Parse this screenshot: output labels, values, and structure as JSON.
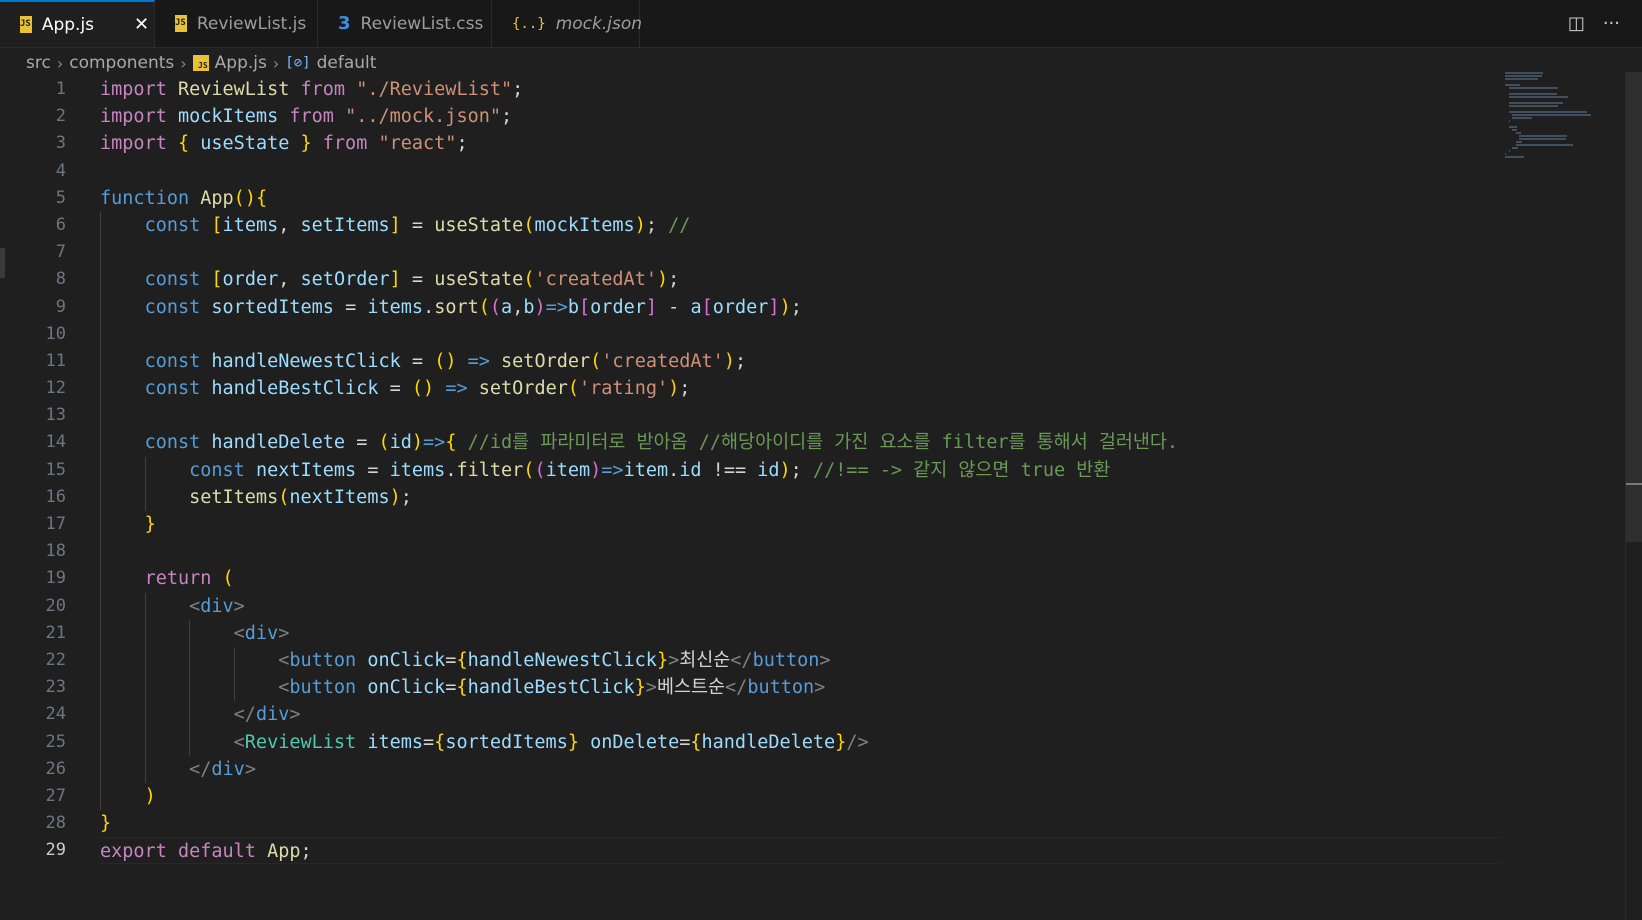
{
  "tabs": [
    {
      "label": "App.js",
      "icon": "js-icon",
      "active": true
    },
    {
      "label": "ReviewList.js",
      "icon": "js-icon",
      "active": false
    },
    {
      "label": "ReviewList.css",
      "icon": "css-icon",
      "active": false
    },
    {
      "label": "mock.json",
      "icon": "json-icon",
      "active": false
    }
  ],
  "tab_close_glyph": "✕",
  "icons": {
    "js": "JS",
    "css": "3",
    "json": "{..}",
    "split": "◫",
    "more": "···",
    "symbol": "[⊘]"
  },
  "breadcrumb": [
    "src",
    "components",
    "App.js",
    "default"
  ],
  "current_line": 29,
  "code": [
    "import ReviewList from \"./ReviewList\";",
    "import mockItems from \"../mock.json\";",
    "import { useState } from \"react\";",
    "",
    "function App(){",
    "    const [items, setItems] = useState(mockItems); //",
    "",
    "    const [order, setOrder] = useState('createdAt');",
    "    const sortedItems = items.sort((a,b)=>b[order] - a[order]);",
    "",
    "    const handleNewestClick = () => setOrder('createdAt');",
    "    const handleBestClick = () => setOrder('rating');",
    "",
    "    const handleDelete = (id)=>{ //id를 파라미터로 받아옴 //해당아이디를 가진 요소를 filter를 통해서 걸러낸다.",
    "        const nextItems = items.filter((item)=>item.id !== id); //!== -> 같지 않으면 true 반환",
    "        setItems(nextItems);",
    "    }",
    "",
    "    return (",
    "        <div>",
    "            <div>",
    "                <button onClick={handleNewestClick}>최신순</button>",
    "                <button onClick={handleBestClick}>베스트순</button>",
    "            </div>",
    "            <ReviewList items={sortedItems} onDelete={handleDelete}/>",
    "        </div>",
    "    )",
    "}",
    "export default App;"
  ]
}
